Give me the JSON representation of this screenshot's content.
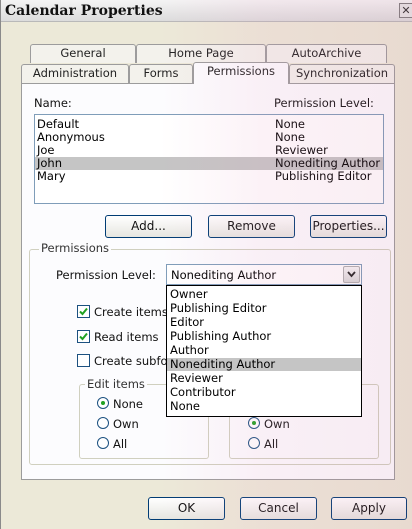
{
  "window": {
    "title": "Calendar Properties",
    "close_glyph": "✕"
  },
  "tabs": {
    "row1": [
      "General",
      "Home Page",
      "AutoArchive"
    ],
    "row2": [
      "Administration",
      "Forms",
      "Permissions",
      "Synchronization"
    ],
    "active": "Permissions"
  },
  "list": {
    "name_header": "Name:",
    "level_header": "Permission Level:",
    "rows": [
      {
        "name": "Default",
        "level": "None"
      },
      {
        "name": "Anonymous",
        "level": "None"
      },
      {
        "name": "Joe",
        "level": "Reviewer"
      },
      {
        "name": "John",
        "level": "Nonediting Author",
        "selected": true
      },
      {
        "name": "Mary",
        "level": "Publishing Editor"
      }
    ]
  },
  "buttons": {
    "add": "Add...",
    "remove": "Remove",
    "properties": "Properties..."
  },
  "permissions": {
    "group_title": "Permissions",
    "level_label": "Permission Level:",
    "level_value": "Nonediting Author",
    "options": [
      "Owner",
      "Publishing Editor",
      "Editor",
      "Publishing Author",
      "Author",
      "Nonediting Author",
      "Reviewer",
      "Contributor",
      "None"
    ],
    "highlighted_option": "Nonediting Author",
    "create_items": "Create items",
    "read_items": "Read items",
    "create_subfolders": "Create subfol",
    "create_items_checked": true,
    "read_items_checked": true,
    "create_subfolders_checked": false,
    "edit_items": {
      "title": "Edit items",
      "none": "None",
      "own": "Own",
      "all": "All",
      "selected": "None"
    },
    "delete_items": {
      "own": "Own",
      "all": "All",
      "selected": "Own"
    }
  },
  "footer": {
    "ok": "OK",
    "cancel": "Cancel",
    "apply": "Apply"
  },
  "colors": {
    "accent_check": "#21a121",
    "selection": "#c5c5c5",
    "field_border": "#7f9db9"
  }
}
